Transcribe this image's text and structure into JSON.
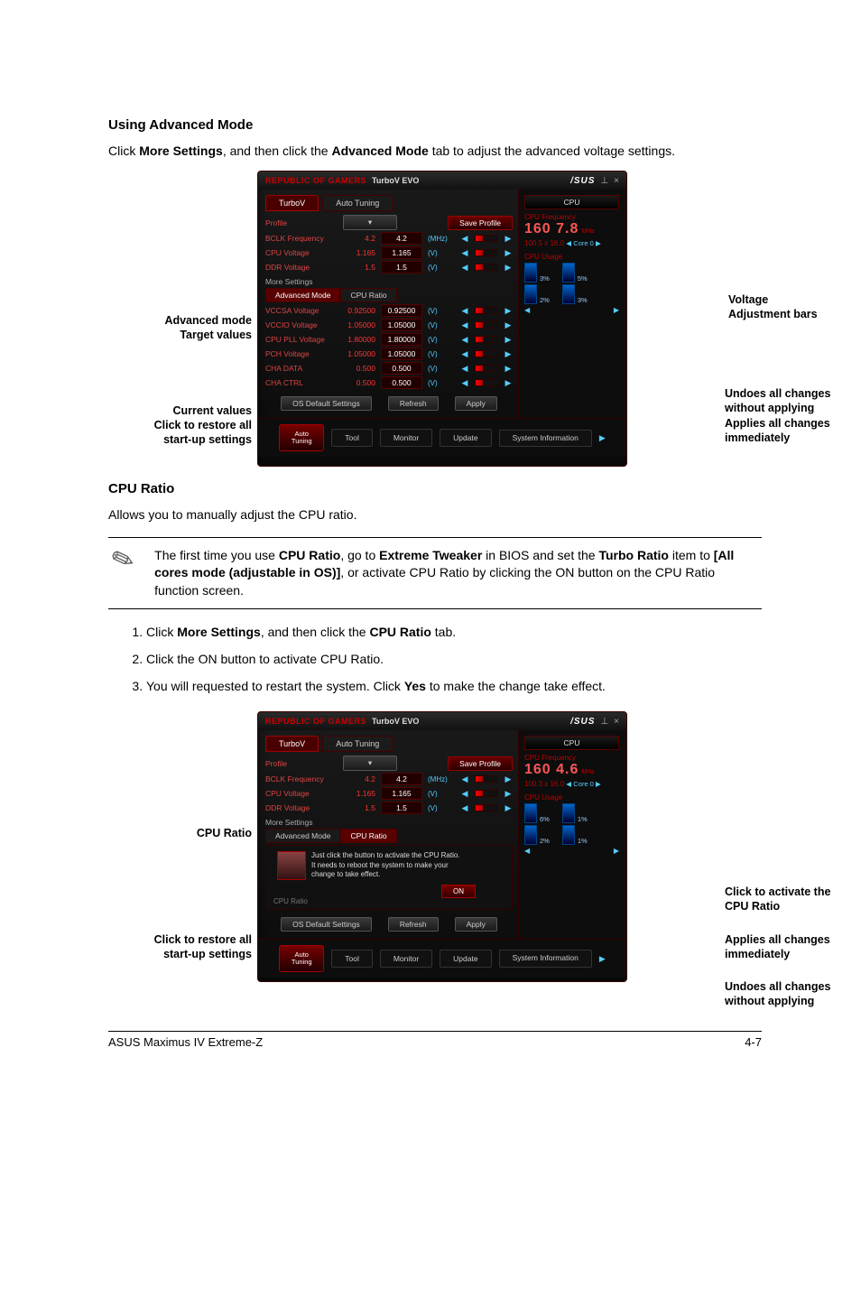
{
  "section1_title": "Using Advanced Mode",
  "section1_body_pre": "Click ",
  "section1_body_b1": "More Settings",
  "section1_body_mid": ", and then click the ",
  "section1_body_b2": "Advanced Mode",
  "section1_body_post": " tab to adjust the advanced voltage settings.",
  "titlebar": {
    "rog": "REPUBLIC OF GAMERS",
    "product": "TurboV EVO",
    "brand": "/SUS",
    "pin": "⊥",
    "close": "×"
  },
  "tabs": {
    "turbov": "TurboV",
    "autotune": "Auto Tuning"
  },
  "profile_row": {
    "label": "Profile",
    "save": "Save Profile"
  },
  "basic_rows": [
    {
      "label": "BCLK Frequency",
      "cur": "4.2",
      "tgt": "4.2",
      "unit": "(MHz)"
    },
    {
      "label": "CPU Voltage",
      "cur": "1.165",
      "tgt": "1.165",
      "unit": "(V)"
    },
    {
      "label": "DDR Voltage",
      "cur": "1.5",
      "tgt": "1.5",
      "unit": "(V)"
    }
  ],
  "more_settings_label": "More Settings",
  "subtabs": {
    "adv": "Advanced Mode",
    "cpu_ratio": "CPU Ratio"
  },
  "adv_rows": [
    {
      "label": "VCCSA Voltage",
      "cur": "0.92500",
      "tgt": "0.92500",
      "unit": "(V)"
    },
    {
      "label": "VCCIO Voltage",
      "cur": "1.05000",
      "tgt": "1.05000",
      "unit": "(V)"
    },
    {
      "label": "CPU PLL Voltage",
      "cur": "1.80000",
      "tgt": "1.80000",
      "unit": "(V)"
    },
    {
      "label": "PCH Voltage",
      "cur": "1.05000",
      "tgt": "1.05000",
      "unit": "(V)"
    },
    {
      "label": "CHA DATA",
      "cur": "0.500",
      "tgt": "0.500",
      "unit": "(V)"
    },
    {
      "label": "CHA CTRL",
      "cur": "0.500",
      "tgt": "0.500",
      "unit": "(V)"
    }
  ],
  "buttons": {
    "os_default": "OS Default Settings",
    "refresh": "Refresh",
    "apply": "Apply"
  },
  "footer": {
    "auto_l1": "Auto",
    "auto_l2": "Tuning",
    "tool": "Tool",
    "monitor": "Monitor",
    "update": "Update",
    "sysinfo": "System Information"
  },
  "cpu_panel": {
    "btn": "CPU",
    "freq_label": "CPU Frequency",
    "freq1": "160 7.8",
    "freq1_unit": "MHz",
    "detail1": "100.5 x 16.0",
    "core1": "Core 0",
    "usage_label": "CPU Usage",
    "u1a": "3%",
    "u1b": "5%",
    "u1c": "2%",
    "u1d": "3%",
    "freq2": "160 4.6",
    "freq2_unit": "MHz",
    "detail2": "100.3 x 16.0",
    "core2": "Core 0",
    "u2a": "6%",
    "u2b": "1%",
    "u2c": "2%",
    "u2d": "1%"
  },
  "callouts1": {
    "advanced_mode": "Advanced mode",
    "target_values": "Target values",
    "current_values": "Current values",
    "click_restore": "Click to restore all start-up settings",
    "voltage_bars": "Voltage Adjustment bars",
    "undoes": "Undoes all changes without applying",
    "applies": "Applies all changes immediately"
  },
  "section2_title": "CPU Ratio",
  "section2_intro": "Allows you to manually adjust the CPU ratio.",
  "note": {
    "p1a": "The first time you use ",
    "p1b": "CPU Ratio",
    "p1c": ", go to ",
    "p1d": "Extreme Tweaker",
    "p1e": " in BIOS and set the ",
    "p1f": "Turbo Ratio",
    "p1g": " item to ",
    "p1h": "[All cores mode (adjustable in OS)]",
    "p1i": ", or activate CPU Ratio by clicking the ON button on the CPU Ratio function screen."
  },
  "steps": {
    "s1a": "Click ",
    "s1b": "More Settings",
    "s1c": ", and then click the ",
    "s1d": "CPU Ratio",
    "s1e": " tab.",
    "s2": "Click the ON button to activate CPU Ratio.",
    "s3a": "You will requested to restart the system. Click ",
    "s3b": "Yes",
    "s3c": " to make the change take effect."
  },
  "ratio_panel": {
    "msg_l1": "Just click the button to activate the CPU Ratio.",
    "msg_l2": "It needs to reboot the system to make your",
    "msg_l3": "change to take effect.",
    "label": "CPU Ratio",
    "on": "ON"
  },
  "callouts2": {
    "cpu_ratio": "CPU Ratio",
    "click_restore": "Click to restore all start-up settings",
    "click_activate": "Click to activate the CPU Ratio",
    "applies": "Applies all changes immediately",
    "undoes": "Undoes all changes without applying"
  },
  "pagefoot": {
    "left": "ASUS Maximus IV Extreme-Z",
    "right": "4-7"
  }
}
